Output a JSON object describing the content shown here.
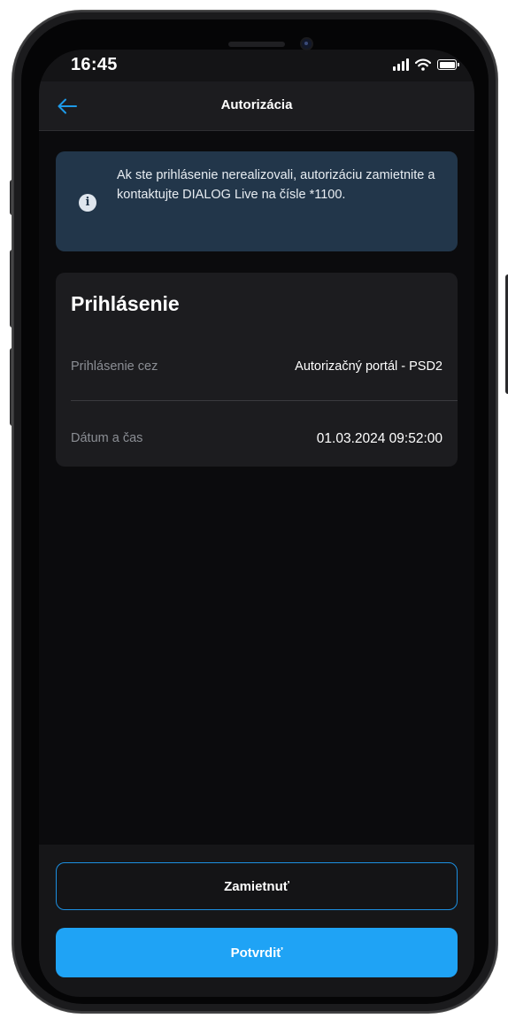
{
  "status_bar": {
    "time": "16:45",
    "icons": [
      "signal-icon",
      "wifi-icon",
      "battery-icon"
    ]
  },
  "nav": {
    "back_icon": "arrow-left-icon",
    "title": "Autorizácia"
  },
  "info_banner": {
    "icon": "info-icon",
    "icon_glyph": "i",
    "text": "Ak ste prihlásenie nerealizovali, autorizáciu zamietnite a kontaktujte DIALOG Live na čísle *1100."
  },
  "card": {
    "title": "Prihlásenie",
    "rows": [
      {
        "label": "Prihlásenie cez",
        "value": "Autorizačný portál - PSD2"
      },
      {
        "label": "Dátum a čas",
        "value": "01.03.2024 09:52:00"
      }
    ]
  },
  "actions": {
    "reject_label": "Zamietnuť",
    "confirm_label": "Potvrdiť"
  },
  "colors": {
    "accent": "#1fa3f5",
    "info_background": "#22364a",
    "card_background": "#1c1c1f",
    "screen_background": "#0b0b0d"
  }
}
